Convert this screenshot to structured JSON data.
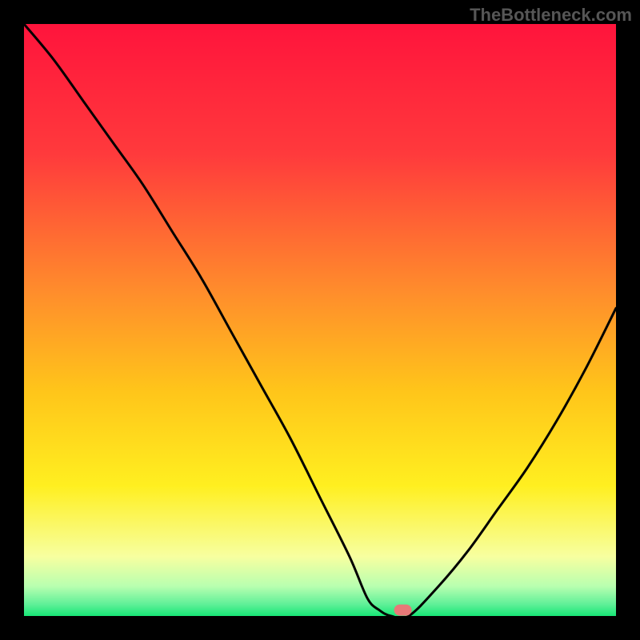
{
  "watermark": "TheBottleneck.com",
  "chart_data": {
    "type": "line",
    "title": "",
    "xlabel": "",
    "ylabel": "",
    "xlim": [
      0,
      100
    ],
    "ylim": [
      0,
      100
    ],
    "x": [
      0,
      5,
      10,
      15,
      20,
      25,
      30,
      35,
      40,
      45,
      50,
      55,
      58,
      60,
      62,
      65,
      70,
      75,
      80,
      85,
      90,
      95,
      100
    ],
    "values": [
      100,
      94,
      87,
      80,
      73,
      65,
      57,
      48,
      39,
      30,
      20,
      10,
      3,
      1,
      0,
      0,
      5,
      11,
      18,
      25,
      33,
      42,
      52
    ],
    "marker": {
      "x": 64,
      "y": 1
    },
    "gradient_stops": [
      {
        "pos": 0.0,
        "color": "#ff143c"
      },
      {
        "pos": 0.22,
        "color": "#ff3a3c"
      },
      {
        "pos": 0.45,
        "color": "#ff8c2c"
      },
      {
        "pos": 0.62,
        "color": "#ffc51a"
      },
      {
        "pos": 0.78,
        "color": "#ffef20"
      },
      {
        "pos": 0.9,
        "color": "#f7ffa0"
      },
      {
        "pos": 0.95,
        "color": "#b8ffb0"
      },
      {
        "pos": 0.98,
        "color": "#60f098"
      },
      {
        "pos": 1.0,
        "color": "#18e676"
      }
    ],
    "marker_color": "#e87878",
    "line_color": "#000000"
  }
}
